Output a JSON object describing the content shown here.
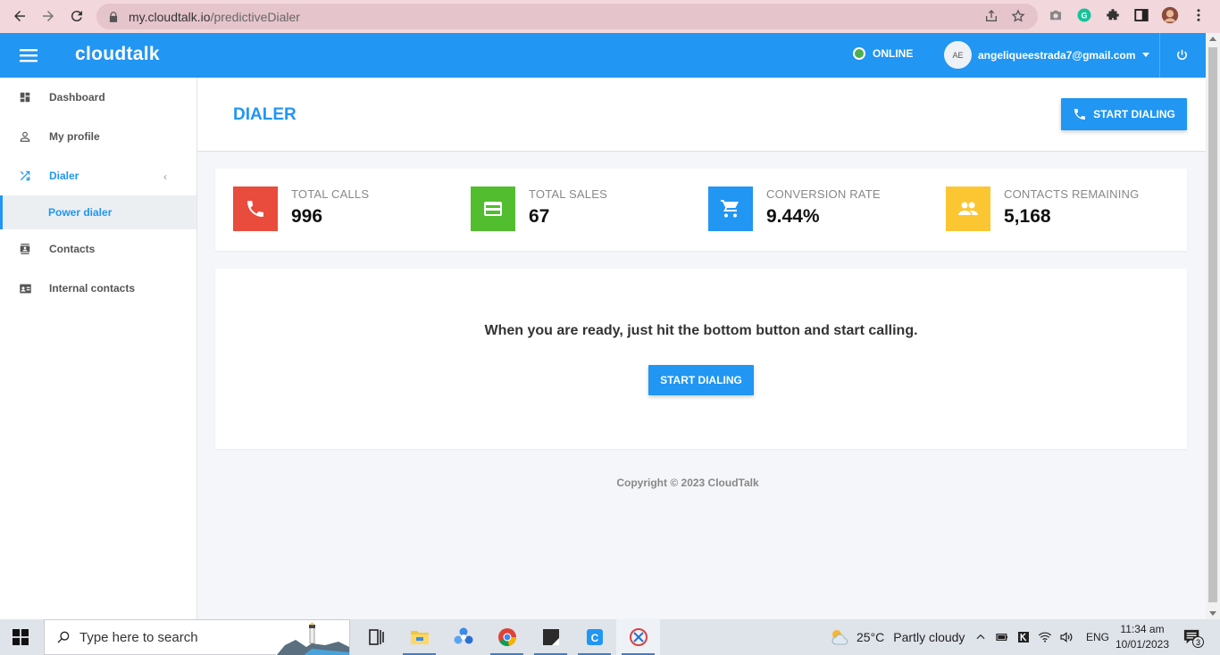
{
  "browser": {
    "url_host": "my.cloudtalk.io",
    "url_path": "/predictiveDialer"
  },
  "header": {
    "logo": "cloudtalk",
    "status": "ONLINE",
    "avatar_initials": "AE",
    "user_email": "angeliqueestrada7@gmail.com"
  },
  "sidebar": {
    "items": [
      {
        "label": "Dashboard",
        "icon": "dashboard-icon"
      },
      {
        "label": "My profile",
        "icon": "person-icon"
      },
      {
        "label": "Dialer",
        "icon": "shuffle-icon",
        "active": true
      },
      {
        "label": "Contacts",
        "icon": "contacts-icon"
      },
      {
        "label": "Internal contacts",
        "icon": "contact-card-icon"
      }
    ],
    "sub_item": "Power dialer"
  },
  "page": {
    "title": "DIALER",
    "start_button": "START DIALING"
  },
  "stats": [
    {
      "label": "TOTAL CALLS",
      "value": "996",
      "color": "#e94b3c",
      "icon": "phone-icon"
    },
    {
      "label": "TOTAL SALES",
      "value": "67",
      "color": "#52bd2f",
      "icon": "credit-card-icon"
    },
    {
      "label": "CONVERSION RATE",
      "value": "9.44%",
      "color": "#2196f3",
      "icon": "cart-icon"
    },
    {
      "label": "CONTACTS REMAINING",
      "value": "5,168",
      "color": "#fbc632",
      "icon": "people-icon"
    }
  ],
  "ready": {
    "message": "When you are ready, just hit the bottom button and start calling.",
    "button": "START DIALING"
  },
  "footer": {
    "copyright": "Copyright © 2023 CloudTalk"
  },
  "taskbar": {
    "search_placeholder": "Type here to search",
    "temperature": "25°C",
    "condition": "Partly cloudy",
    "language": "ENG",
    "time": "11:34 am",
    "date": "10/01/2023",
    "notification_count": "3"
  },
  "colors": {
    "accent": "#2196f3",
    "online": "#4caf50"
  }
}
